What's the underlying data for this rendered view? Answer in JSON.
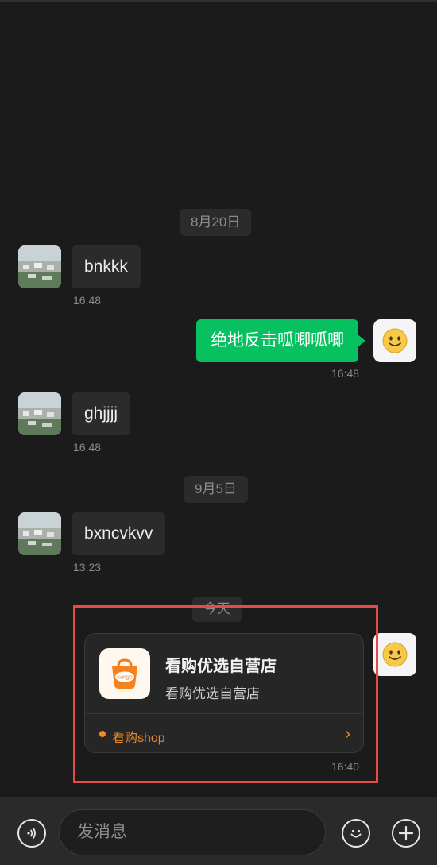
{
  "chat": {
    "dates": [
      "8月20日",
      "9月5日",
      "今天"
    ],
    "messages": [
      {
        "text": "bnkkk",
        "time": "16:48"
      },
      {
        "text": "绝地反击呱唧呱唧",
        "time": "16:48"
      },
      {
        "text": "ghjjjj",
        "time": "16:48"
      },
      {
        "text": "bxncvkvv",
        "time": "13:23"
      }
    ],
    "card": {
      "title": "看购优选自营店",
      "subtitle": "看购优选自营店",
      "source": "看购shop",
      "logo_text": "kango",
      "time": "16:40"
    }
  },
  "input": {
    "placeholder": "发消息"
  },
  "icons": {
    "voice": "voice-icon",
    "emoji": "emoji-icon",
    "plus": "plus-icon",
    "chevron": "chevron-right-icon",
    "avatar_self": "smiley-icon",
    "logo": "shopping-bag-icon"
  },
  "colors": {
    "background": "#1b1b1b",
    "bubble_incoming": "#2b2b2b",
    "bubble_outgoing": "#07c160",
    "accent": "#f08a24",
    "highlight": "#e84a4a"
  }
}
